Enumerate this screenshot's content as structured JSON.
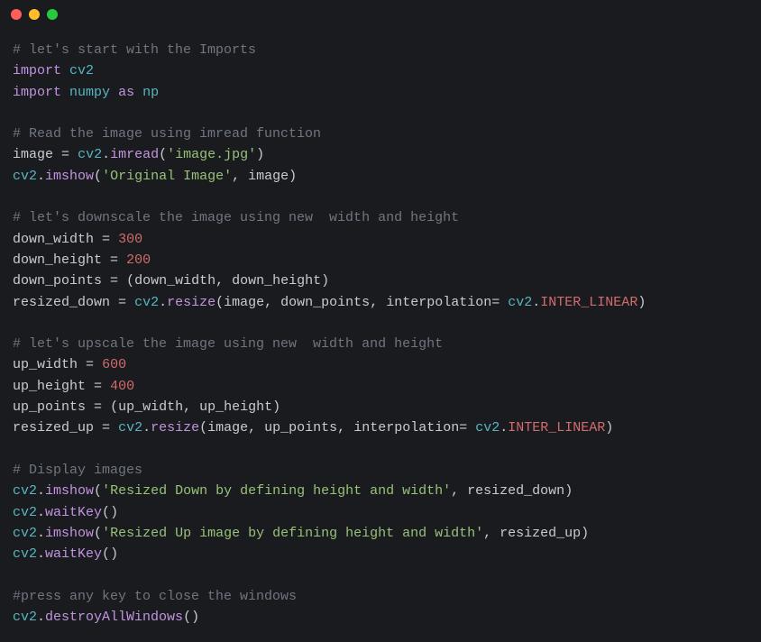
{
  "colors": {
    "bg": "#1a1b1f",
    "comment": "#6f7680",
    "keyword": "#c294e0",
    "func": "#56b6c2",
    "string": "#97c278",
    "number": "#d26b6b",
    "text": "#c7ccd1"
  },
  "titlebar": {
    "dots": [
      "red",
      "yellow",
      "green"
    ]
  },
  "code": {
    "lines": [
      {
        "t": "comment",
        "c1": "# let's start with the Imports"
      },
      {
        "t": "import1",
        "kw1": "import",
        "sp1": " ",
        "mod1": "cv2"
      },
      {
        "t": "import2",
        "kw1": "import",
        "sp1": " ",
        "mod1": "numpy",
        "sp2": " ",
        "kw2": "as",
        "sp3": " ",
        "mod2": "np"
      },
      {
        "t": "blank"
      },
      {
        "t": "comment",
        "c1": "# Read the image using imread function"
      },
      {
        "t": "assign_call",
        "lhs": "image",
        "sp1": " ",
        "eq": "=",
        "sp2": " ",
        "obj": "cv2",
        "dot": ".",
        "meth": "imread",
        "lp": "(",
        "str1": "'image.jpg'",
        "rp": ")"
      },
      {
        "t": "call2",
        "obj": "cv2",
        "dot": ".",
        "meth": "imshow",
        "lp": "(",
        "str1": "'Original Image'",
        "comma": ", ",
        "arg1": "image",
        "rp": ")"
      },
      {
        "t": "blank"
      },
      {
        "t": "comment",
        "c1": "# let's downscale the image using new  width and height"
      },
      {
        "t": "assign_num",
        "lhs": "down_width",
        "sp1": " ",
        "eq": "=",
        "sp2": " ",
        "num": "300"
      },
      {
        "t": "assign_num",
        "lhs": "down_height",
        "sp1": " ",
        "eq": "=",
        "sp2": " ",
        "num": "200"
      },
      {
        "t": "assign_tuple",
        "lhs": "down_points",
        "sp1": " ",
        "eq": "=",
        "sp2": " ",
        "lp": "(",
        "a1": "down_width",
        "comma": ", ",
        "a2": "down_height",
        "rp": ")"
      },
      {
        "t": "resize",
        "lhs": "resized_down",
        "sp1": " ",
        "eq": "=",
        "sp2": " ",
        "obj": "cv2",
        "dot": ".",
        "meth": "resize",
        "lp": "(",
        "a1": "image",
        "c1": ", ",
        "a2": "down_points",
        "c2": ", ",
        "kw": "interpolation",
        "eq2": "= ",
        "obj2": "cv2",
        "dot2": ".",
        "lit": "INTER_LINEAR",
        "rp": ")"
      },
      {
        "t": "blank"
      },
      {
        "t": "comment",
        "c1": "# let's upscale the image using new  width and height"
      },
      {
        "t": "assign_num",
        "lhs": "up_width",
        "sp1": " ",
        "eq": "=",
        "sp2": " ",
        "num": "600"
      },
      {
        "t": "assign_num",
        "lhs": "up_height",
        "sp1": " ",
        "eq": "=",
        "sp2": " ",
        "num": "400"
      },
      {
        "t": "assign_tuple",
        "lhs": "up_points",
        "sp1": " ",
        "eq": "=",
        "sp2": " ",
        "lp": "(",
        "a1": "up_width",
        "comma": ", ",
        "a2": "up_height",
        "rp": ")"
      },
      {
        "t": "resize",
        "lhs": "resized_up",
        "sp1": " ",
        "eq": "=",
        "sp2": " ",
        "obj": "cv2",
        "dot": ".",
        "meth": "resize",
        "lp": "(",
        "a1": "image",
        "c1": ", ",
        "a2": "up_points",
        "c2": ", ",
        "kw": "interpolation",
        "eq2": "= ",
        "obj2": "cv2",
        "dot2": ".",
        "lit": "INTER_LINEAR",
        "rp": ")"
      },
      {
        "t": "blank"
      },
      {
        "t": "comment",
        "c1": "# Display images"
      },
      {
        "t": "call2",
        "obj": "cv2",
        "dot": ".",
        "meth": "imshow",
        "lp": "(",
        "str1": "'Resized Down by defining height and width'",
        "comma": ", ",
        "arg1": "resized_down",
        "rp": ")"
      },
      {
        "t": "call0",
        "obj": "cv2",
        "dot": ".",
        "meth": "waitKey",
        "lp": "(",
        "rp": ")"
      },
      {
        "t": "call2",
        "obj": "cv2",
        "dot": ".",
        "meth": "imshow",
        "lp": "(",
        "str1": "'Resized Up image by defining height and width'",
        "comma": ", ",
        "arg1": "resized_up",
        "rp": ")"
      },
      {
        "t": "call0",
        "obj": "cv2",
        "dot": ".",
        "meth": "waitKey",
        "lp": "(",
        "rp": ")"
      },
      {
        "t": "blank"
      },
      {
        "t": "comment",
        "c1": "#press any key to close the windows"
      },
      {
        "t": "call0",
        "obj": "cv2",
        "dot": ".",
        "meth": "destroyAllWindows",
        "lp": "(",
        "rp": ")"
      }
    ]
  }
}
